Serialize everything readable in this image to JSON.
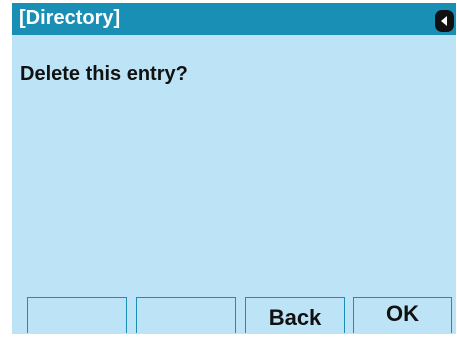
{
  "header": {
    "title": "[Directory]",
    "back_icon": "left-arrow-icon"
  },
  "main": {
    "message": "Delete this entry?"
  },
  "softkeys": [
    {
      "label": ""
    },
    {
      "label": ""
    },
    {
      "label": "Back"
    },
    {
      "label": "OK"
    }
  ],
  "colors": {
    "titlebar": "#1a8fb5",
    "background": "#bde4f6",
    "text": "#111111"
  }
}
